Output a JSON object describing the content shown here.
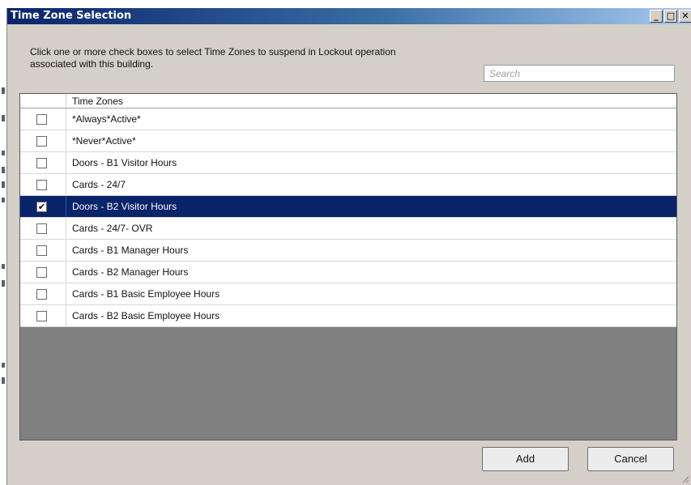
{
  "window": {
    "title": "Time Zone Selection"
  },
  "title_buttons": {
    "minimize": "_",
    "maximize": "□",
    "close": "✕"
  },
  "instructions": {
    "line1": "Click one or more check boxes to select Time Zones to suspend in Lockout operation",
    "line2": "associated with this building."
  },
  "search": {
    "placeholder": "Search",
    "value": ""
  },
  "grid": {
    "column_header": "Time Zones",
    "rows": [
      {
        "label": "*Always*Active*",
        "checked": false,
        "selected": false
      },
      {
        "label": "*Never*Active*",
        "checked": false,
        "selected": false
      },
      {
        "label": "Doors - B1 Visitor Hours",
        "checked": false,
        "selected": false
      },
      {
        "label": "Cards - 24/7",
        "checked": false,
        "selected": false
      },
      {
        "label": "Doors - B2 Visitor Hours",
        "checked": true,
        "selected": true
      },
      {
        "label": "Cards - 24/7- OVR",
        "checked": false,
        "selected": false
      },
      {
        "label": "Cards - B1 Manager Hours",
        "checked": false,
        "selected": false
      },
      {
        "label": "Cards - B2 Manager Hours",
        "checked": false,
        "selected": false
      },
      {
        "label": "Cards - B1 Basic Employee Hours",
        "checked": false,
        "selected": false
      },
      {
        "label": "Cards - B2 Basic Employee Hours",
        "checked": false,
        "selected": false
      }
    ]
  },
  "buttons": {
    "add": "Add",
    "cancel": "Cancel"
  },
  "colors": {
    "selection": "#0a246a",
    "window": "#d4d0c8",
    "grid_empty": "#808080"
  }
}
